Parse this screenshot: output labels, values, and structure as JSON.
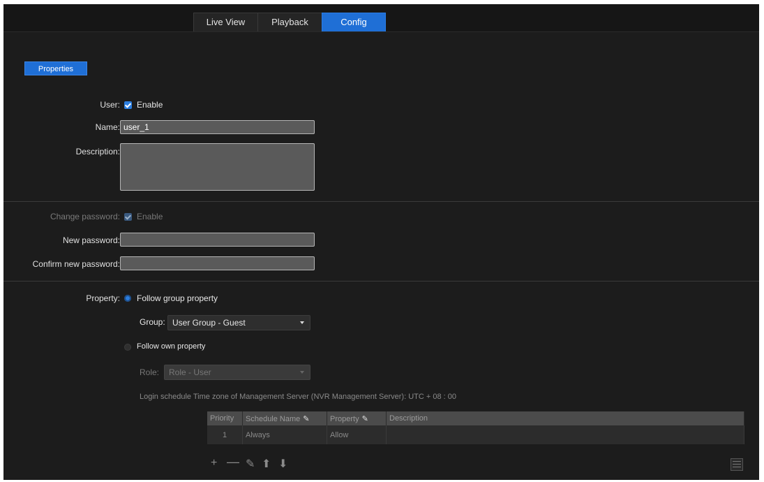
{
  "nav": {
    "tabs": [
      {
        "label": "Live View"
      },
      {
        "label": "Playback"
      },
      {
        "label": "Config"
      }
    ]
  },
  "properties_button": "Properties",
  "user": {
    "label": "User:",
    "enable_label": "Enable"
  },
  "name": {
    "label": "Name:",
    "value": "user_1"
  },
  "description": {
    "label": "Description:",
    "value": ""
  },
  "password": {
    "change_label": "Change password:",
    "enable_label": "Enable",
    "new_label": "New password:",
    "confirm_label": "Confirm new password:"
  },
  "property": {
    "label": "Property:",
    "follow_group": "Follow group property",
    "group_label": "Group:",
    "group_value": "User Group - Guest",
    "follow_own": "Follow own property",
    "role_label": "Role:",
    "role_value": "Role - User"
  },
  "login_schedule": {
    "text": "Login schedule   Time zone of Management Server (NVR Management Server): UTC + 08 : 00"
  },
  "schedule_table": {
    "headers": [
      "Priority",
      "Schedule Name",
      "Property",
      "Description"
    ],
    "rows": [
      {
        "priority": "1",
        "schedule_name": "Always",
        "property": "Allow",
        "description": ""
      }
    ]
  },
  "toolbar": {
    "icons": [
      "add-icon",
      "remove-icon",
      "edit-icon",
      "move-up-icon",
      "move-down-icon",
      "calendar-icon"
    ]
  },
  "colors": {
    "accent": "#1f6fd6",
    "background": "#1c1c1c"
  }
}
